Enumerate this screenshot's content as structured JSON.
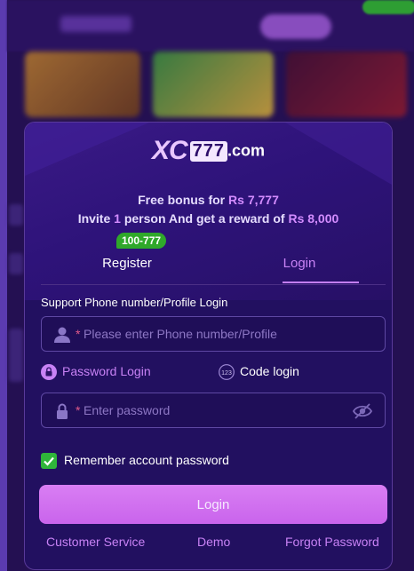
{
  "brand": {
    "xc": "XC",
    "num": "777",
    "suffix": ".com"
  },
  "promo": {
    "line1_prefix": "Free bonus for ",
    "line1_amount": "Rs 7,777",
    "line2_prefix": "Invite ",
    "line2_count": "1",
    "line2_middle": " person And get a reward of ",
    "line2_amount": "Rs 8,000"
  },
  "tabs": {
    "register_label": "Register",
    "register_badge": "100-777",
    "login_label": "Login"
  },
  "form": {
    "support_label": "Support Phone number/Profile Login",
    "phone": {
      "required_mark": "*",
      "placeholder": "Please enter Phone number/Profile",
      "value": ""
    },
    "password_mode_label": "Password Login",
    "code_mode_label": "Code login",
    "password": {
      "required_mark": "*",
      "placeholder": "Enter password",
      "value": ""
    },
    "remember_label": "Remember account password",
    "remember_checked": true,
    "login_button": "Login"
  },
  "footer": {
    "customer_service": "Customer Service",
    "demo": "Demo",
    "forgot_password": "Forgot Password"
  },
  "icons": {
    "user": "user-icon",
    "lock": "lock-icon",
    "eye_off": "eye-off-icon",
    "code": "code-123-icon",
    "check": "check-icon"
  },
  "colors": {
    "accent": "#c882f5",
    "badge_green": "#2fa82a",
    "checkbox_green": "#2fb53a",
    "login_button": "#d97ef3"
  }
}
